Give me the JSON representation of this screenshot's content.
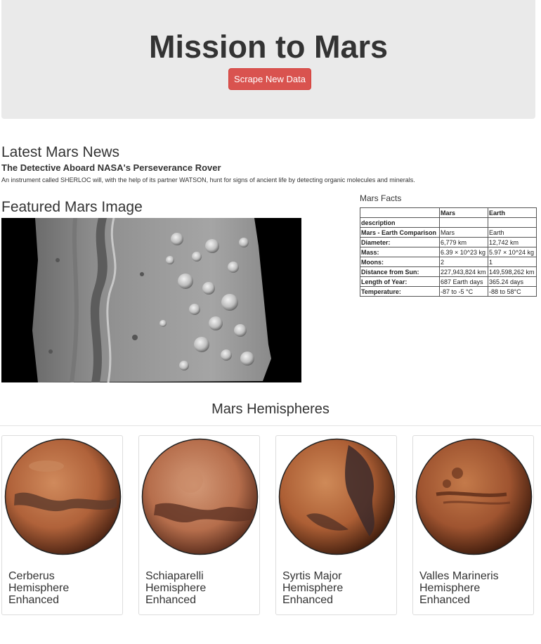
{
  "header": {
    "title": "Mission to Mars",
    "scrape_button": "Scrape New Data"
  },
  "news": {
    "heading": "Latest Mars News",
    "title": "The Detective Aboard NASA's Perseverance Rover",
    "paragraph": "An instrument called SHERLOC will, with the help of its partner WATSON, hunt for signs of ancient life by detecting organic molecules and minerals."
  },
  "featured": {
    "heading": "Featured Mars Image"
  },
  "facts": {
    "heading": "Mars Facts",
    "columns": [
      "",
      "Mars",
      "Earth"
    ],
    "index_label": "description",
    "rows": [
      {
        "label": "Mars - Earth Comparison",
        "mars": "Mars",
        "earth": "Earth"
      },
      {
        "label": "Diameter:",
        "mars": "6,779 km",
        "earth": "12,742 km"
      },
      {
        "label": "Mass:",
        "mars": "6.39 × 10^23 kg",
        "earth": "5.97 × 10^24 kg"
      },
      {
        "label": "Moons:",
        "mars": "2",
        "earth": "1"
      },
      {
        "label": "Distance from Sun:",
        "mars": "227,943,824 km",
        "earth": "149,598,262 km"
      },
      {
        "label": "Length of Year:",
        "mars": "687 Earth days",
        "earth": "365.24 days"
      },
      {
        "label": "Temperature:",
        "mars": "-87 to -5 °C",
        "earth": "-88 to 58°C"
      }
    ]
  },
  "hemispheres": {
    "heading": "Mars Hemispheres",
    "items": [
      {
        "title": "Cerberus Hemisphere Enhanced"
      },
      {
        "title": "Schiaparelli Hemisphere Enhanced"
      },
      {
        "title": "Syrtis Major Hemisphere Enhanced"
      },
      {
        "title": "Valles Marineris Hemisphere Enhanced"
      }
    ]
  }
}
